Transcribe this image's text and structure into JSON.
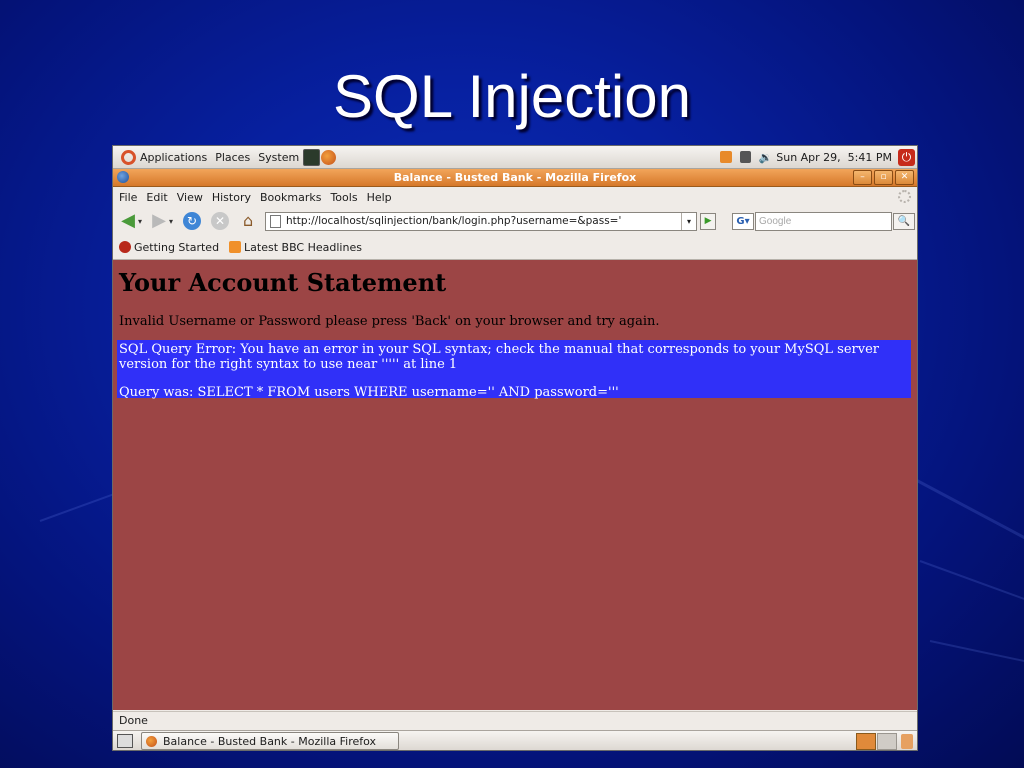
{
  "slide": {
    "title": "SQL Injection"
  },
  "top_panel": {
    "menus": [
      "Applications",
      "Places",
      "System"
    ],
    "clock": "Sun Apr 29,  5:41 PM"
  },
  "window": {
    "title": "Balance - Busted Bank - Mozilla Firefox"
  },
  "menubar": {
    "items": [
      "File",
      "Edit",
      "View",
      "History",
      "Bookmarks",
      "Tools",
      "Help"
    ]
  },
  "navbar": {
    "url": "http://localhost/sqlinjection/bank/login.php?username=&pass='",
    "search_placeholder": "Google"
  },
  "bookmarks": {
    "items": [
      "Getting Started",
      "Latest BBC Headlines"
    ]
  },
  "page": {
    "heading": "Your Account Statement",
    "message": "Invalid Username or Password please press 'Back' on your browser and try again.",
    "error_line1": "SQL Query Error: You have an error in your SQL syntax; check the manual that corresponds to your MySQL server version for the right syntax to use near ''''' at line 1",
    "error_line2": "Query was: SELECT * FROM users WHERE username='' AND password='''"
  },
  "statusbar": {
    "text": "Done"
  },
  "taskbar": {
    "task_label": "Balance - Busted Bank - Mozilla Firefox"
  },
  "colors": {
    "page_background": "#9c4545",
    "error_background": "#3030f8",
    "titlebar": "#e08a3a",
    "slide_background": "#0720a0"
  }
}
